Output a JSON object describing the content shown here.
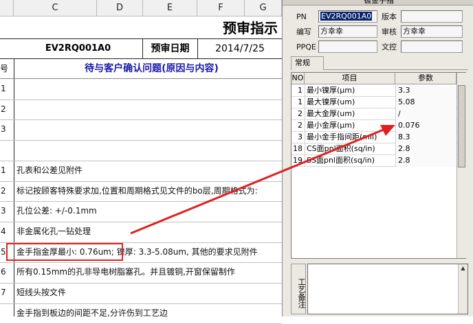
{
  "sheet": {
    "col_headers": [
      "C",
      "D",
      "E",
      "F",
      "G"
    ],
    "title": "预审指示",
    "pn_value": "EV2RQ001A0",
    "date_label": "预审日期",
    "date_value": "2014/7/25",
    "rownum_header": "号",
    "question_header": "待与客户确认问题(原因与内容)",
    "rows": [
      {
        "num": "1",
        "text": ""
      },
      {
        "num": "2",
        "text": ""
      },
      {
        "num": "3",
        "text": ""
      },
      {
        "num": "",
        "text": ""
      },
      {
        "num": "1",
        "text": "孔表和公差见附件"
      },
      {
        "num": "2",
        "text": "标记按顾客特殊要求加,位置和周期格式见文件的bo层,周期格式为:"
      },
      {
        "num": "3",
        "text": "孔位公差: +/-0.1mm"
      },
      {
        "num": "4",
        "text": "非金属化孔一钻处理"
      },
      {
        "num": "5",
        "text_boxed": "金手指金厚最小: 0.76um",
        "text_rest": "; 镍厚: 3.3-5.08um, 其他的要求见附件"
      },
      {
        "num": "6",
        "text": "所有0.15mm的孔非导电树脂塞孔。并且镀铜,开窗保留制作"
      },
      {
        "num": "7",
        "text": "短线头按文件"
      },
      {
        "num": "",
        "text": "金手指到板边的间距不足,分许伤到工艺边"
      }
    ]
  },
  "panel": {
    "title": "镀金手指",
    "pn_label": "PN",
    "pn_value": "EV2RQ001A0",
    "version_label": "版本",
    "version_value": "",
    "author_label": "编写",
    "author_value": "方幸幸",
    "reviewer_label": "审核",
    "reviewer_value": "方幸幸",
    "ppqe_label": "PPQE",
    "ppqe_value": "",
    "doccontrol_label": "文控",
    "doccontrol_value": "",
    "tab_label": "常规",
    "grid_headers": [
      "NO",
      "项目",
      "参数"
    ],
    "grid_rows": [
      {
        "no": "1",
        "item": "最小镍厚(μm)",
        "value": "3.3"
      },
      {
        "no": "1",
        "item": "最大镍厚(um)",
        "value": "5.08"
      },
      {
        "no": "2",
        "item": "最大金厚(um)",
        "value": "/"
      },
      {
        "no": "2",
        "item": "最小金厚(μm)",
        "value": "0.076"
      },
      {
        "no": "3",
        "item": "最小金手指间距(mil)",
        "value": "8.3"
      },
      {
        "no": "18",
        "item": "CS面pnl面积(sq/in)",
        "value": "2.8"
      },
      {
        "no": "19",
        "item": "SS面pnl面积(sq/in)",
        "value": "2.8"
      }
    ],
    "notes_label": "工艺备注"
  },
  "colors": {
    "annotation_red": "#e02020",
    "blue_text": "#1a1aa8",
    "selection_blue": "#0a246a"
  }
}
